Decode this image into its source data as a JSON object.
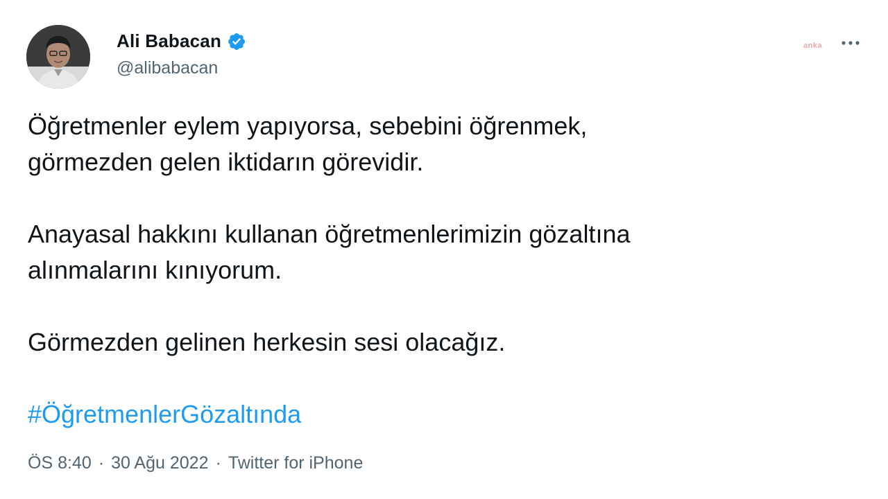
{
  "author": {
    "name": "Ali Babacan",
    "handle": "@alibabacan",
    "verified": true,
    "avatar_icon": "profile-photo"
  },
  "watermark": "anka",
  "tweet": {
    "paragraphs": [
      "Öğretmenler eylem yapıyorsa, sebebini öğrenmek,\ngörmezden gelen iktidarın görevidir.",
      "Anayasal hakkını kullanan öğretmenlerimizin gözaltına\nalınmalarını kınıyorum.",
      "Görmezden gelinen herkesin sesi olacağız."
    ],
    "hashtag": "#ÖğretmenlerGözaltında"
  },
  "meta": {
    "time": "ÖS 8:40",
    "separator": "·",
    "date": "30 Ağu 2022",
    "source": "Twitter for iPhone"
  },
  "colors": {
    "link": "#1d9bf0",
    "secondary_text": "#536471",
    "primary_text": "#0f1419"
  }
}
